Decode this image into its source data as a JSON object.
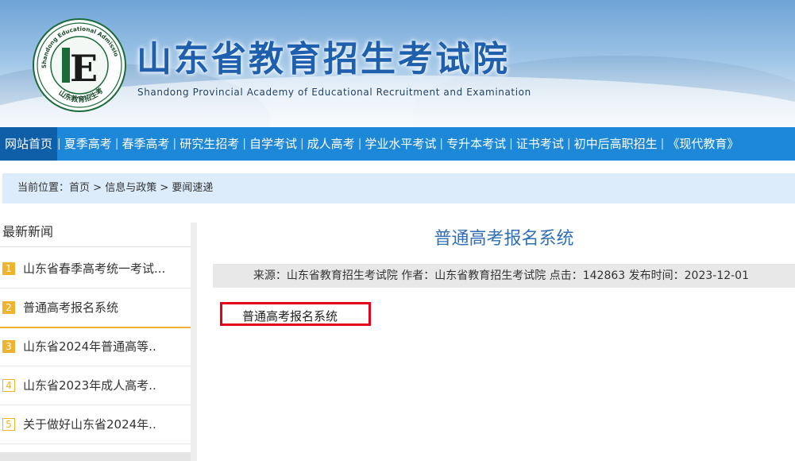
{
  "header": {
    "title_cn": "山东省教育招生考试院",
    "title_en": "Shandong Provincial Academy of Educational Recruitment and Examination",
    "seal_text_en": "Shandong Educational Admission & Examinations",
    "seal_text_cn": "山东教育招生考试",
    "seal_letter": "E"
  },
  "nav": {
    "items": [
      {
        "label": "网站首页",
        "active": true
      },
      {
        "label": "夏季高考"
      },
      {
        "label": "春季高考"
      },
      {
        "label": "研究生招考"
      },
      {
        "label": "自学考试"
      },
      {
        "label": "成人高考"
      },
      {
        "label": "学业水平考试"
      },
      {
        "label": "专升本考试"
      },
      {
        "label": "证书考试"
      },
      {
        "label": "初中后高职招生"
      },
      {
        "label": "《现代教育》"
      }
    ]
  },
  "breadcrumb": {
    "label": "当前位置：",
    "items": [
      "首页",
      "信息与政策",
      "要闻速递"
    ],
    "separator": ">"
  },
  "sidebar": {
    "heading": "最新新闻",
    "items": [
      {
        "num": "1",
        "text": "山东省春季高考统一考试...",
        "style": "filled"
      },
      {
        "num": "2",
        "text": "普通高考报名系统",
        "style": "filled",
        "active": true
      },
      {
        "num": "3",
        "text": "山东省2024年普通高等..",
        "style": "filled"
      },
      {
        "num": "4",
        "text": "山东省2023年成人高考..",
        "style": "outline"
      },
      {
        "num": "5",
        "text": "关于做好山东省2024年..",
        "style": "outline"
      }
    ]
  },
  "article": {
    "title": "普通高考报名系统",
    "meta": "来源：山东省教育招生考试院  作者：山东省教育招生考试院  点击：142863  发布时间：2023-12-01",
    "link_text": "普通高考报名系统"
  },
  "colors": {
    "nav_bg": "#1d87d8",
    "nav_active": "#0e5ea8",
    "title_blue": "#2f6fb7",
    "badge_orange": "#f0b32e",
    "highlight_red": "#e5001c"
  }
}
